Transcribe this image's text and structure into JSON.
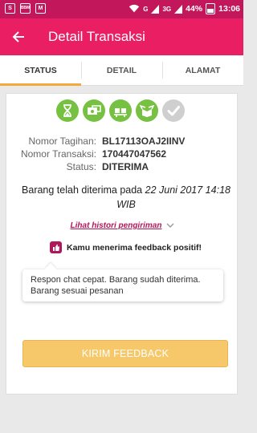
{
  "statusbar": {
    "notif_icons": [
      "S",
      "BBM",
      "M"
    ],
    "signal": "G",
    "network": "3G",
    "battery": "44%",
    "time": "13:06"
  },
  "appbar": {
    "title": "Detail Transaksi",
    "back_icon": "arrow-left-icon"
  },
  "tabs": [
    {
      "label": "STATUS",
      "active": true
    },
    {
      "label": "DETAIL",
      "active": false
    },
    {
      "label": "ALAMAT",
      "active": false
    }
  ],
  "progress": {
    "steps": [
      {
        "icon": "hourglass-icon",
        "done": true
      },
      {
        "icon": "payment-icon",
        "done": true
      },
      {
        "icon": "packing-icon",
        "done": true
      },
      {
        "icon": "shipping-icon",
        "done": true
      },
      {
        "icon": "check-icon",
        "done": false
      }
    ]
  },
  "info": {
    "invoice_label": "Nomor Tagihan:",
    "invoice_value": "BL17113OAJ2IINV",
    "transaction_label": "Nomor Transaksi:",
    "transaction_value": "170447047562",
    "status_label": "Status:",
    "status_value": "DITERIMA"
  },
  "received": {
    "text": "Barang telah diterima pada",
    "date": "22 Juni 2017 14:18 WIB"
  },
  "history_link": "Lihat histori pengiriman",
  "feedback": {
    "heading": "Kamu menerima feedback positif!",
    "message": "Respon chat cepat. Barang sudah diterima. Barang sesuai pesanan"
  },
  "button": {
    "label": "KIRIM FEEDBACK"
  },
  "colors": {
    "statusbar": "#c2185b",
    "appbar": "#e91e63",
    "tab_indicator": "#f4a73a",
    "step_done": "#76c142",
    "step_pending": "#cfcfcf",
    "link": "#b0175a",
    "button": "#f6c869"
  }
}
